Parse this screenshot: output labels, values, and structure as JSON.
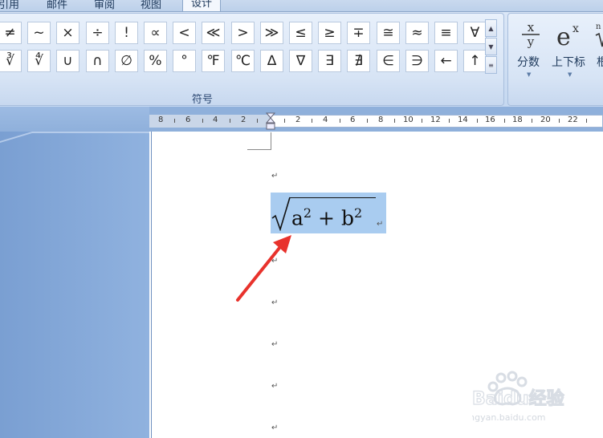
{
  "ribbon": {
    "tabs": [
      "引用",
      "邮件",
      "审阅",
      "视图",
      "设计"
    ],
    "active_tab": "设计",
    "symbols_group_label": "符号",
    "symbols_row1": [
      "≠",
      "~",
      "×",
      "÷",
      "!",
      "∝",
      "<",
      "≪",
      ">",
      "≫",
      "≤",
      "≥",
      "∓",
      "≅",
      "≈",
      "≡",
      "∀"
    ],
    "symbols_row2": [
      "∛",
      "∜",
      "∪",
      "∩",
      "∅",
      "%",
      "°",
      "℉",
      "℃",
      "∆",
      "∇",
      "∃",
      "∄",
      "∈",
      "∋",
      "←",
      "↑"
    ],
    "structures": [
      {
        "label": "分数"
      },
      {
        "label": "上下标"
      },
      {
        "label": "根"
      }
    ]
  },
  "ruler": {
    "labels": [
      "8",
      "6",
      "4",
      "2",
      "2",
      "4",
      "6",
      "8",
      "10",
      "12",
      "14",
      "16",
      "18",
      "20",
      "22"
    ]
  },
  "document": {
    "equation": {
      "radicand_a": "a",
      "exp_a": "2",
      "plus": "+",
      "radicand_b": "b",
      "exp_b": "2"
    },
    "paragraph_mark": "↵"
  },
  "watermark": {
    "brand": "Baidu经验",
    "url": "jingyan.baidu.com"
  },
  "colors": {
    "annotation_arrow": "#e8322c",
    "selection": "#a9ccf0"
  }
}
